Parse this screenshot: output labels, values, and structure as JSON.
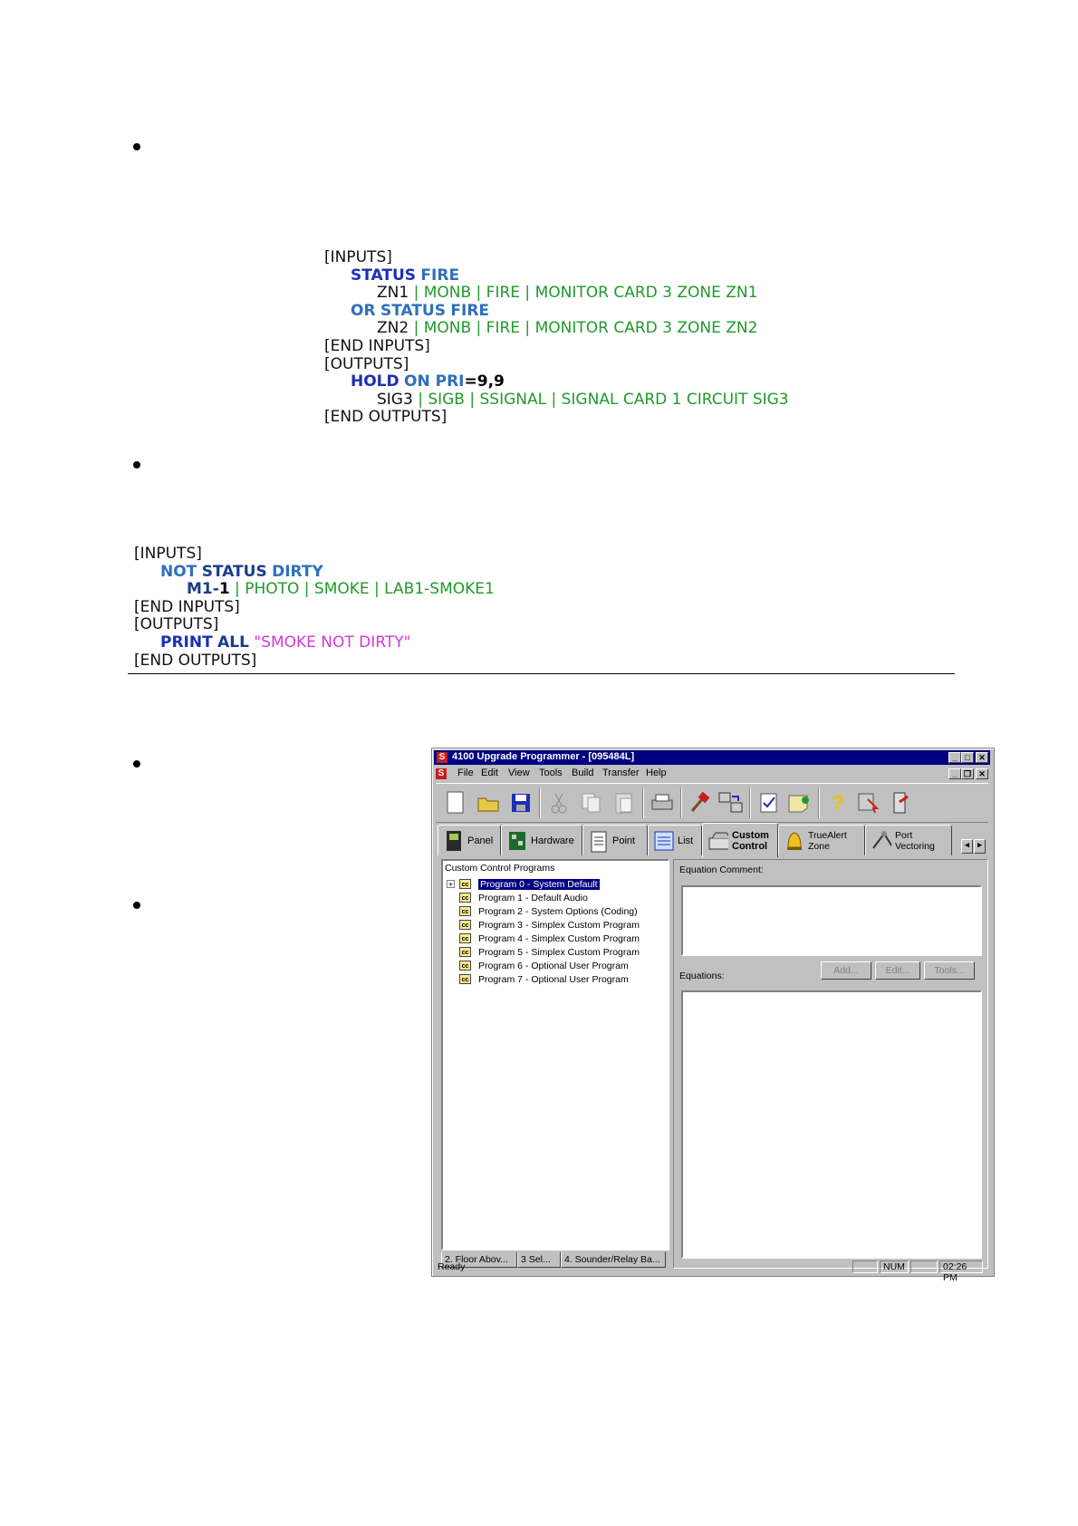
{
  "code_block_1": {
    "line1": "[INPUTS]",
    "line2_kw1": "STATUS",
    "line2_kw2": "FIRE",
    "line3_pt": "ZN1",
    "line3_rest": " | MONB | FIRE | MONITOR CARD 3 ZONE ZN1",
    "line4_kw0": "OR",
    "line4_kw1": "STATUS",
    "line4_kw2": "FIRE",
    "line5_pt": "ZN2",
    "line5_rest": " | MONB | FIRE | MONITOR CARD 3 ZONE ZN2",
    "line6": "[END INPUTS]",
    "line7": "[OUTPUTS]",
    "line8_kw1": "HOLD",
    "line8_kw2": "ON PRI",
    "line8_eq": "=",
    "line8_val": "9,9",
    "line9_pt": "SIG3",
    "line9_rest": " | SIGB | SSIGNAL | SIGNAL CARD 1 CIRCUIT SIG3",
    "line10": "[END OUTPUTS]"
  },
  "code_block_2": {
    "line1": "[INPUTS]",
    "line2_kw0": "NOT",
    "line2_kw1": "STATUS",
    "line2_kw2": "DIRTY",
    "line3_pt": "M1-",
    "line3_pt2": "1",
    "line3_rest": " | PHOTO | SMOKE | LAB1-SMOKE1",
    "line4": "[END INPUTS]",
    "line5": "[OUTPUTS]",
    "line6_kw1": "PRINT",
    "line6_kw2": "ALL",
    "line6_str": " \"SMOKE NOT DIRTY\"",
    "line7": "[END OUTPUTS]"
  },
  "window": {
    "title": "4100 Upgrade Programmer - [095484L]",
    "menu": [
      "File",
      "Edit",
      "View",
      "Tools",
      "Build",
      "Transfer",
      "Help"
    ],
    "tabs": [
      {
        "label": "Panel",
        "icon": "panel-icon"
      },
      {
        "label": "Hardware",
        "icon": "hardware-icon"
      },
      {
        "label": "Point",
        "icon": "point-icon"
      },
      {
        "label": "List",
        "icon": "list-icon"
      },
      {
        "label": "Custom Control",
        "icon": "custom-control-icon"
      },
      {
        "label": "TrueAlert Zone",
        "icon": "bell-icon"
      },
      {
        "label": "Port Vectoring",
        "icon": "port-vectoring-icon"
      }
    ],
    "tree_header": "Custom Control Programs",
    "programs": [
      "Program 0 - System Default",
      "Program 1 - Default Audio",
      "Program 2 - System Options (Coding)",
      "Program 3 - Simplex Custom Program",
      "Program 4 - Simplex Custom Program",
      "Program 5 - Simplex Custom Program",
      "Program 6 - Optional User Program",
      "Program 7 - Optional User Program"
    ],
    "bottom_tabs": [
      "2. Floor Abov...",
      "3 Sel...",
      "4. Sounder/Relay Ba..."
    ],
    "equation_comment_label": "Equation Comment:",
    "equations_label": "Equations:",
    "buttons": {
      "add": "Add...",
      "edit": "Edit...",
      "tools": "Tools..."
    },
    "status": {
      "ready": "Ready",
      "num": "NUM",
      "time": "02:26 PM"
    }
  }
}
